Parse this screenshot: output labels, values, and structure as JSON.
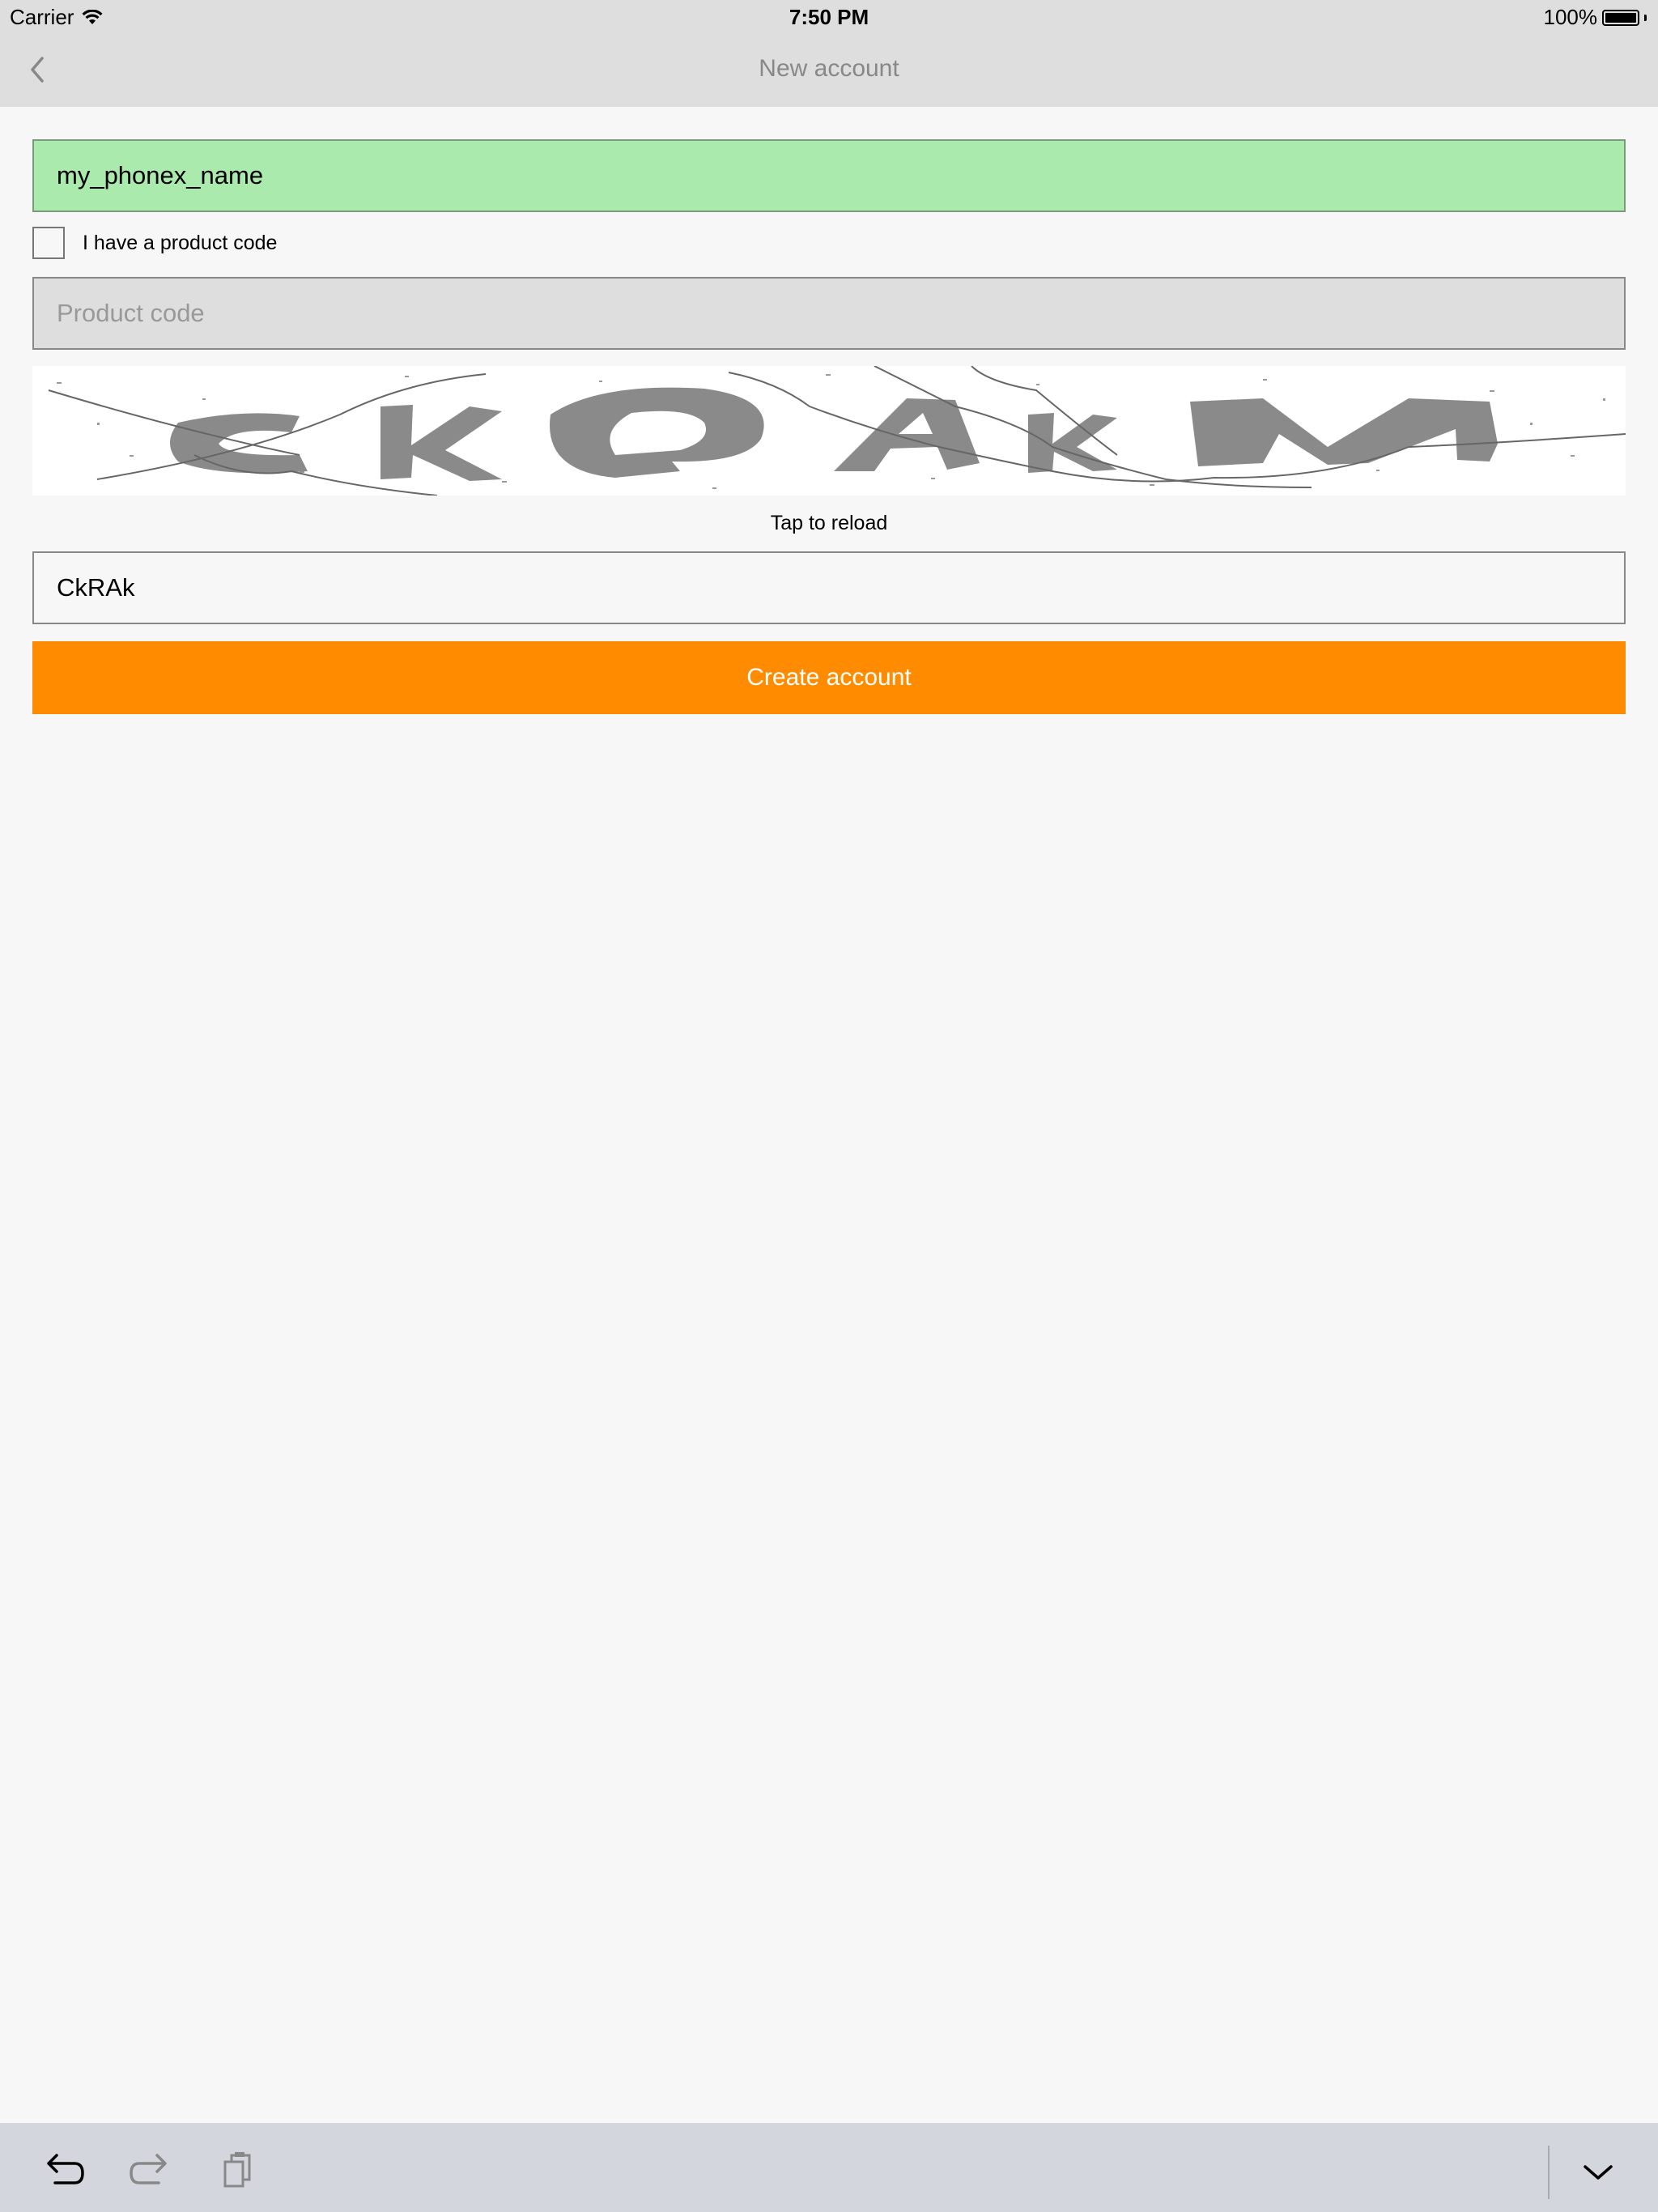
{
  "status_bar": {
    "carrier": "Carrier",
    "time": "7:50 PM",
    "battery": "100%"
  },
  "nav": {
    "title": "New account"
  },
  "form": {
    "username_value": "my_phonex_name",
    "product_code_checkbox_label": "I have a product code",
    "product_code_checked": false,
    "product_code_placeholder": "Product code",
    "captcha_tap_to_reload": "Tap to reload",
    "captcha_input_value": "CkRAk",
    "create_button_label": "Create account"
  },
  "colors": {
    "accent": "#ff8c00",
    "valid_field": "#abeaad",
    "disabled_field": "#dedede"
  },
  "keyboard_toolbar": {
    "icons": [
      "undo-icon",
      "redo-icon",
      "paste-icon",
      "hide-keyboard-icon"
    ]
  }
}
